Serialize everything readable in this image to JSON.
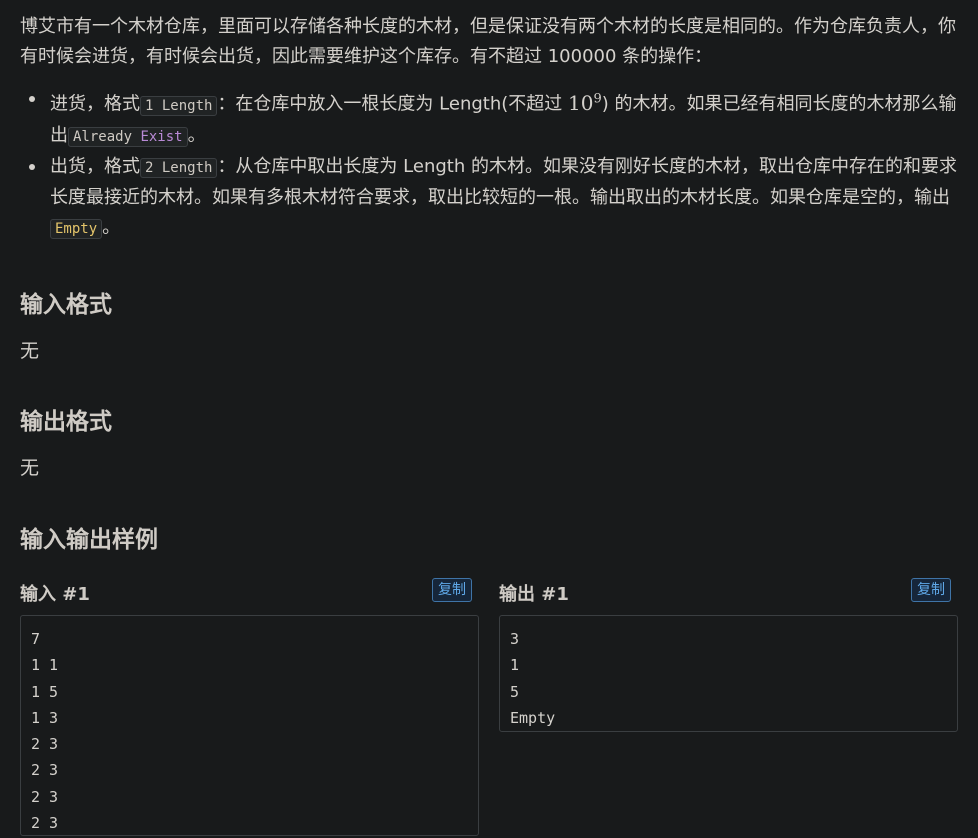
{
  "description": {
    "intro": "博艾市有一个木材仓库，里面可以存储各种长度的木材，但是保证没有两个木材的长度是相同的。作为仓库负责人，你有时候会进货，有时候会出货，因此需要维护这个库存。有不超过 100000 条的操作：",
    "op1": {
      "prefix": "进货，格式",
      "code": "1 Length",
      "mid": "：在仓库中放入一根长度为 Length(不超过 ",
      "pow_base": "10",
      "pow_exp": "9",
      "mid2": ") 的木材。如果已经有相同长度的木材那么输出",
      "code2_a": "Already ",
      "code2_b": "Exist",
      "suffix": "。"
    },
    "op2": {
      "prefix": "出货，格式",
      "code": "2 Length",
      "mid": "：从仓库中取出长度为 Length 的木材。如果没有刚好长度的木材，取出仓库中存在的和要求长度最接近的木材。如果有多根木材符合要求，取出比较短的一根。输出取出的木材长度。如果仓库是空的，输出",
      "code2": "Empty",
      "suffix": "。"
    }
  },
  "input_format": {
    "title": "输入格式",
    "text": "无"
  },
  "output_format": {
    "title": "输出格式",
    "text": "无"
  },
  "samples": {
    "title": "输入输出样例",
    "input": {
      "label": "输入 #1",
      "copy_label": "复制",
      "lines": [
        "7",
        "1 1",
        "1 5",
        "1 3",
        "2 3",
        "2 3",
        "2 3",
        "2 3"
      ]
    },
    "output": {
      "label": "输出 #1",
      "copy_label": "复制",
      "lines": [
        "3",
        "1",
        "5",
        "Empty"
      ]
    }
  },
  "colors": {
    "background": "#181a1b",
    "text": "#d4d1cc",
    "copy_button": "#5fa8e8",
    "keyword": "#b98ad6",
    "highlight": "#e3c46a"
  }
}
